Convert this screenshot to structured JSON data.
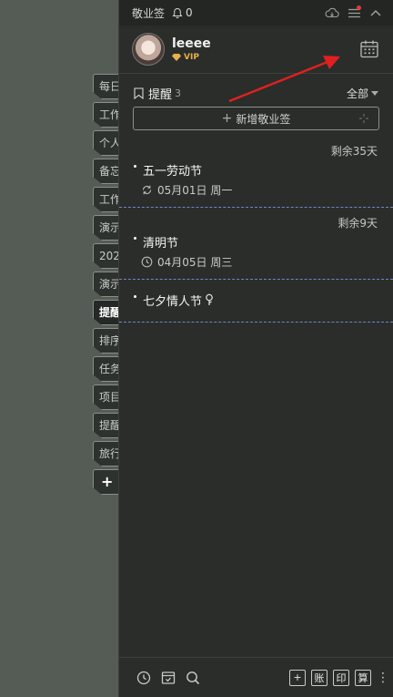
{
  "app": {
    "title": "敬业签",
    "notification_count": "0"
  },
  "side_tabs": [
    {
      "label": "每日",
      "active": false
    },
    {
      "label": "工作",
      "active": false
    },
    {
      "label": "个人",
      "active": false
    },
    {
      "label": "备忘",
      "active": false
    },
    {
      "label": "工作",
      "active": false
    },
    {
      "label": "演示",
      "active": false
    },
    {
      "label": "202",
      "active": false
    },
    {
      "label": "演示",
      "active": false
    },
    {
      "label": "提醒",
      "active": true
    },
    {
      "label": "排序",
      "active": false
    },
    {
      "label": "任务",
      "active": false
    },
    {
      "label": "项目",
      "active": false
    },
    {
      "label": "提醒",
      "active": false
    },
    {
      "label": "旅行",
      "active": false
    },
    {
      "label": "+",
      "active": false
    }
  ],
  "user": {
    "name": "leeee",
    "badge": "VIP"
  },
  "section": {
    "title": "提醒",
    "count": "3",
    "filter": "全部"
  },
  "add_button": {
    "label": "新增敬业签"
  },
  "items": [
    {
      "remaining": "剩余35天",
      "title": "五一劳动节",
      "date": "05月01日 周一",
      "repeat": true
    },
    {
      "remaining": "剩余9天",
      "title": "清明节",
      "date": "04月05日 周三",
      "repeat": false
    },
    {
      "remaining": "",
      "title": "七夕情人节",
      "date": "",
      "repeat": false
    }
  ],
  "bottom": {
    "box1": "+",
    "box2": "账",
    "box3": "印",
    "box4": "算",
    "more": "⋮"
  },
  "colors": {
    "panel": "#2a2d2a",
    "accent_arrow": "#e02020",
    "vip": "#e8b04a",
    "dash": "#6f86c9"
  }
}
